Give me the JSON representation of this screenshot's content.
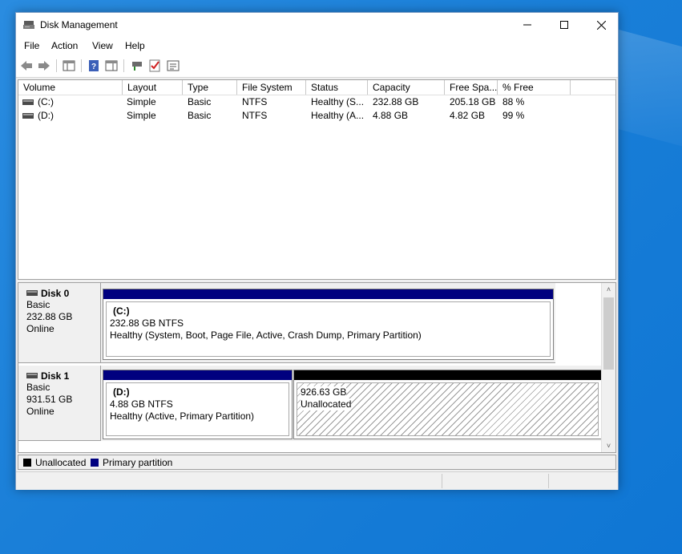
{
  "window": {
    "title": "Disk Management"
  },
  "menu": [
    "File",
    "Action",
    "View",
    "Help"
  ],
  "list": {
    "columns": [
      "Volume",
      "Layout",
      "Type",
      "File System",
      "Status",
      "Capacity",
      "Free Spa...",
      "% Free"
    ],
    "rows": [
      [
        "(C:)",
        "Simple",
        "Basic",
        "NTFS",
        "Healthy (S...",
        "232.88 GB",
        "205.18 GB",
        "88 %"
      ],
      [
        "(D:)",
        "Simple",
        "Basic",
        "NTFS",
        "Healthy (A...",
        "4.88 GB",
        "4.82 GB",
        "99 %"
      ]
    ]
  },
  "disks": [
    {
      "name": "Disk 0",
      "type": "Basic",
      "size": "232.88 GB",
      "status": "Online",
      "partitions": [
        {
          "label": "(C:)",
          "size": "232.88 GB NTFS",
          "status": "Healthy (System, Boot, Page File, Active, Crash Dump, Primary Partition)"
        }
      ]
    },
    {
      "name": "Disk 1",
      "type": "Basic",
      "size": "931.51 GB",
      "status": "Online",
      "partitions": [
        {
          "label": "(D:)",
          "size": "4.88 GB NTFS",
          "status": "Healthy (Active, Primary Partition)"
        },
        {
          "size": "926.63 GB",
          "status": "Unallocated"
        }
      ]
    }
  ],
  "legend": [
    "Unallocated",
    "Primary partition"
  ],
  "colors": {
    "primary": "#00007f",
    "unallocated": "#000000",
    "desktop": "#1a7fd8"
  }
}
